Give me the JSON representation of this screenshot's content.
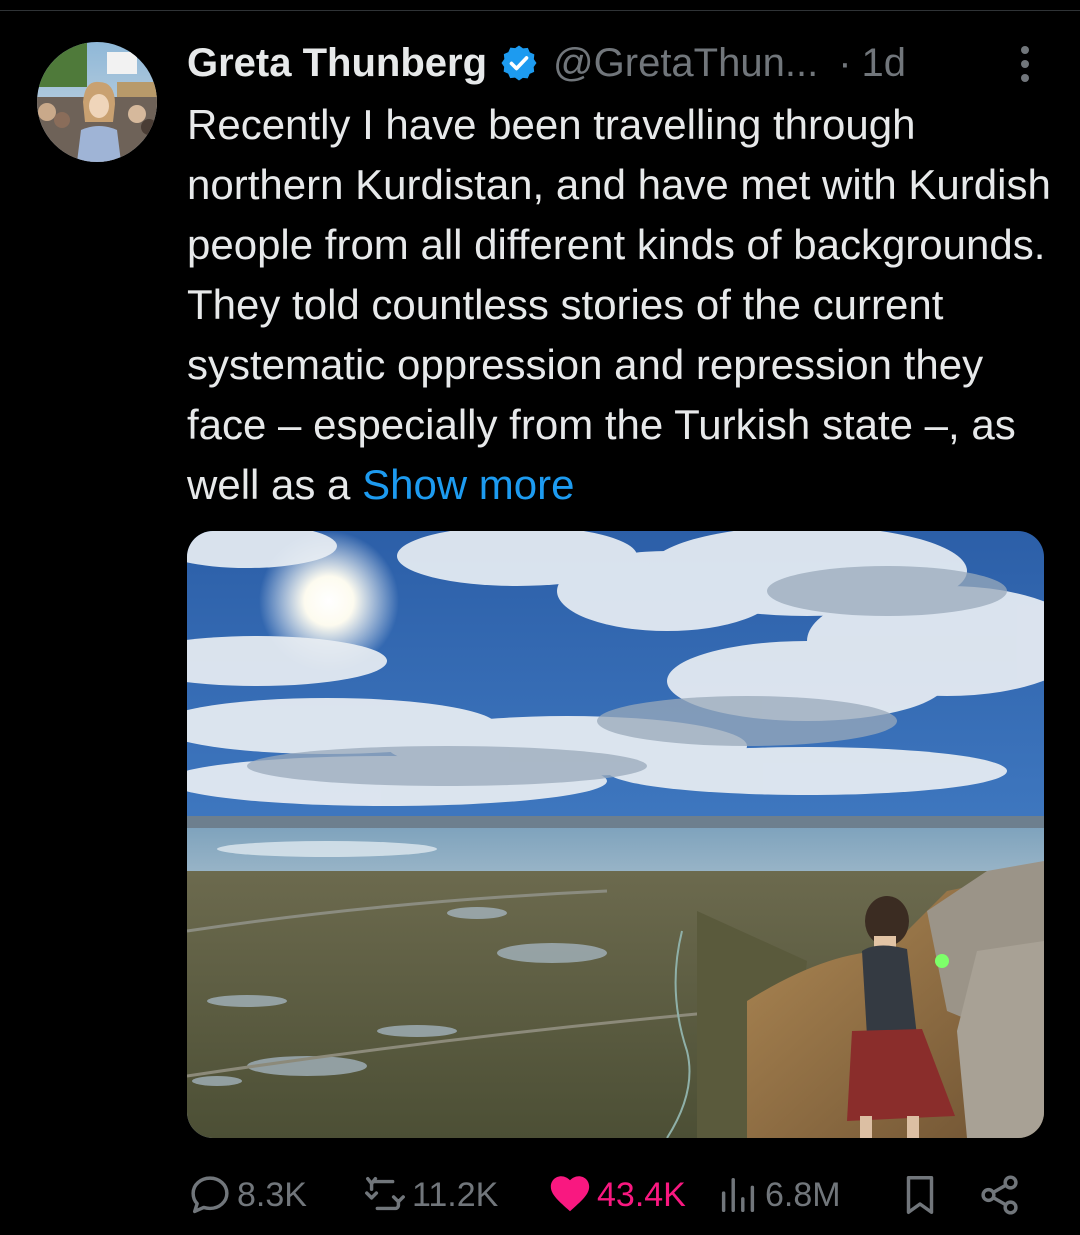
{
  "tweet": {
    "author_name": "Greta Thunberg",
    "handle": "@GretaThun...",
    "separator": "·",
    "time": "1d",
    "text": "Recently I have been travelling through northern Kurdistan, and have met with Kurdish people from all different kinds of backgrounds. They told countless stories of the current systematic oppression and repression they face – especially from the Turkish state –, as well as a ",
    "show_more": "Show more",
    "media_description_icon": "photo"
  },
  "actions": {
    "replies": "8.3K",
    "reposts": "11.2K",
    "likes": "43.4K",
    "views": "6.8M"
  },
  "colors": {
    "background": "#000000",
    "text": "#e7e9ea",
    "secondary": "#71767b",
    "accent": "#1d9bf0",
    "like": "#f91880"
  },
  "icons": {
    "verified": "verified-badge-icon",
    "more": "more-vertical-icon",
    "reply": "reply-icon",
    "repost": "repost-icon",
    "like": "heart-filled-icon",
    "views": "views-chart-icon",
    "bookmark": "bookmark-icon",
    "share": "share-icon"
  }
}
